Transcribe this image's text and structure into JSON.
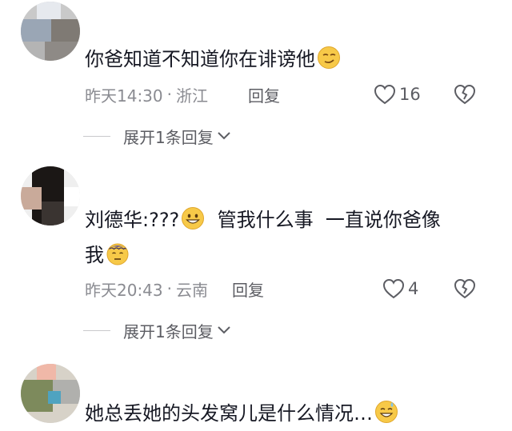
{
  "comments": [
    {
      "text": "你爸知道不知道你在诽谤他",
      "time": "昨天14:30",
      "location": "浙江",
      "reply_label": "回复",
      "likes": "16",
      "expand_label": "展开1条回复"
    },
    {
      "text_line1": "刘德华:???",
      "text_line1b": "  管我什么事  一直说你爸像",
      "text_line2": "我",
      "time": "昨天20:43",
      "location": "云南",
      "reply_label": "回复",
      "likes": "4",
      "expand_label": "展开1条回复"
    },
    {
      "text": "她总丢她的头发窝儿是什么情况…"
    }
  ],
  "colors": {
    "text": "#161823",
    "meta": "#8a8b91",
    "action": "#5c5d63",
    "emoji_yellow": "#f7c948"
  },
  "icons": [
    "heart-icon",
    "broken-heart-icon",
    "chevron-down-icon",
    "smirk-emoji",
    "grin-emoji",
    "dizzy-emoji",
    "sweat-smile-emoji"
  ]
}
